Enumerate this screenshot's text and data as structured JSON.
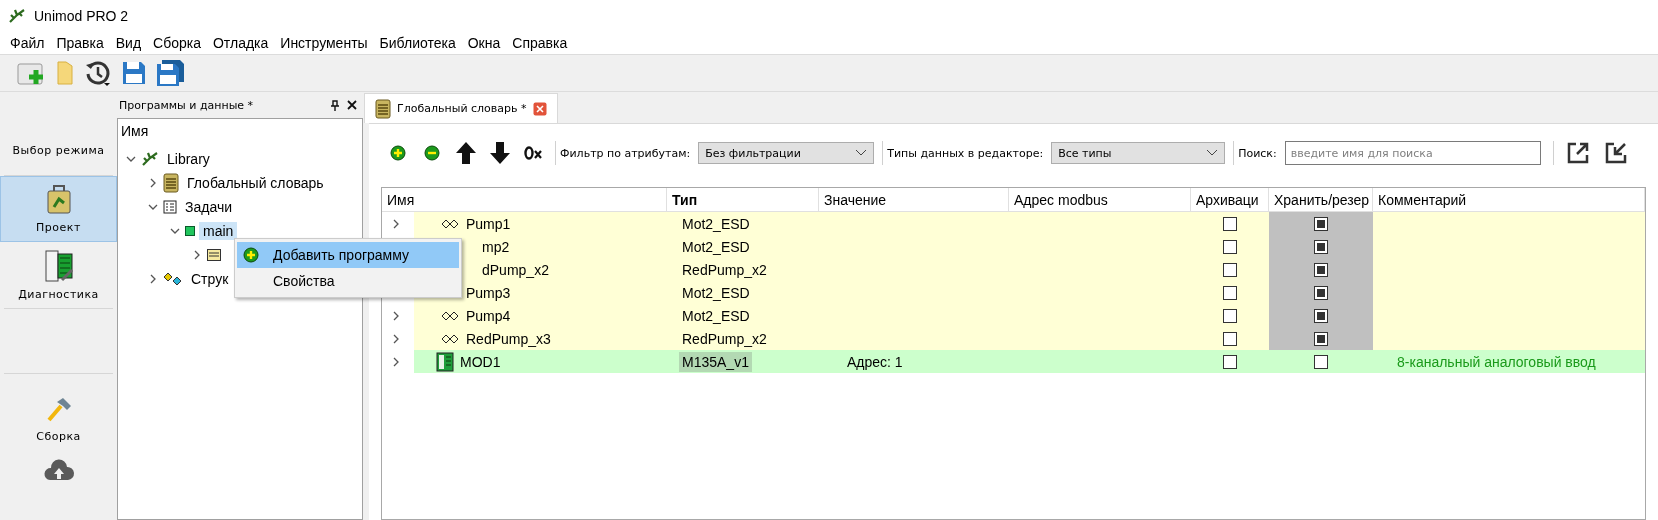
{
  "window": {
    "title": "Unimod PRO 2"
  },
  "menu": [
    "Файл",
    "Правка",
    "Вид",
    "Сборка",
    "Отладка",
    "Инструменты",
    "Библиотека",
    "Окна",
    "Справка"
  ],
  "modes": {
    "title": "Выбор режима",
    "items": [
      {
        "label": "Проект",
        "kind": "project",
        "selected": true
      },
      {
        "label": "Диагностика",
        "kind": "diagnostics",
        "selected": false
      },
      {
        "label": "Сборка",
        "kind": "build",
        "selected": false
      }
    ]
  },
  "tree_panel": {
    "title": "Программы и данные *",
    "header": "Имя",
    "items": [
      {
        "label": "Library",
        "kind": "library",
        "expanded": true,
        "children": [
          {
            "label": "Глобальный словарь",
            "kind": "dictionary",
            "expanded": false
          },
          {
            "label": "Задачи",
            "kind": "tasks",
            "expanded": true,
            "children": [
              {
                "label": "main",
                "kind": "task",
                "expanded": true,
                "selected": true,
                "children": [
                  {
                    "kind": "program",
                    "expanded": false
                  }
                ]
              }
            ]
          },
          {
            "label": "Струк",
            "kind": "structs",
            "expanded": false
          }
        ]
      }
    ]
  },
  "context_menu": [
    {
      "label": "Добавить программу",
      "kind": "add",
      "selected": true
    },
    {
      "label": "Свойства",
      "kind": "plain",
      "selected": false
    }
  ],
  "editor": {
    "tab": {
      "label": "Глобальный словарь *",
      "selected": true
    },
    "filter_label": "Фильтр по атрибутам:",
    "filter_value": "Без фильтрации",
    "types_label": "Типы данных в редакторе:",
    "types_value": "Все типы",
    "search_label": "Поиск:",
    "search": {
      "placeholder": "введите имя для поиска"
    },
    "columns": [
      "Имя",
      "Тип",
      "Значение",
      "Адрес modbus",
      "Архиваци",
      "Хранить/резер",
      "Комментарий"
    ],
    "rows": [
      {
        "kind": "variable",
        "expanded": false,
        "name": "Pump1",
        "partly_hidden": false,
        "type": "Mot2_ESD",
        "archive": false,
        "store": true
      },
      {
        "kind": "variable",
        "name": "mp2",
        "partly_hidden": true,
        "type": "Mot2_ESD",
        "archive": false,
        "store": true
      },
      {
        "kind": "variable",
        "name": "dPump_x2",
        "partly_hidden": true,
        "type": "RedPump_x2",
        "archive": false,
        "store": true
      },
      {
        "kind": "variable",
        "expanded": false,
        "name": "Pump3",
        "partly_hidden": false,
        "type": "Mot2_ESD",
        "archive": false,
        "store": true
      },
      {
        "kind": "variable",
        "expanded": false,
        "name": "Pump4",
        "partly_hidden": false,
        "type": "Mot2_ESD",
        "archive": false,
        "store": true
      },
      {
        "kind": "variable",
        "expanded": false,
        "name": "RedPump_x3",
        "partly_hidden": false,
        "type": "RedPump_x2",
        "archive": false,
        "store": true
      },
      {
        "kind": "module",
        "expanded": false,
        "name": "MOD1",
        "partly_hidden": false,
        "type": "M135A_v1",
        "value": "Адрес: 1",
        "archive": false,
        "store": false,
        "comment": "8-канальный аналоговый ввод"
      }
    ]
  }
}
